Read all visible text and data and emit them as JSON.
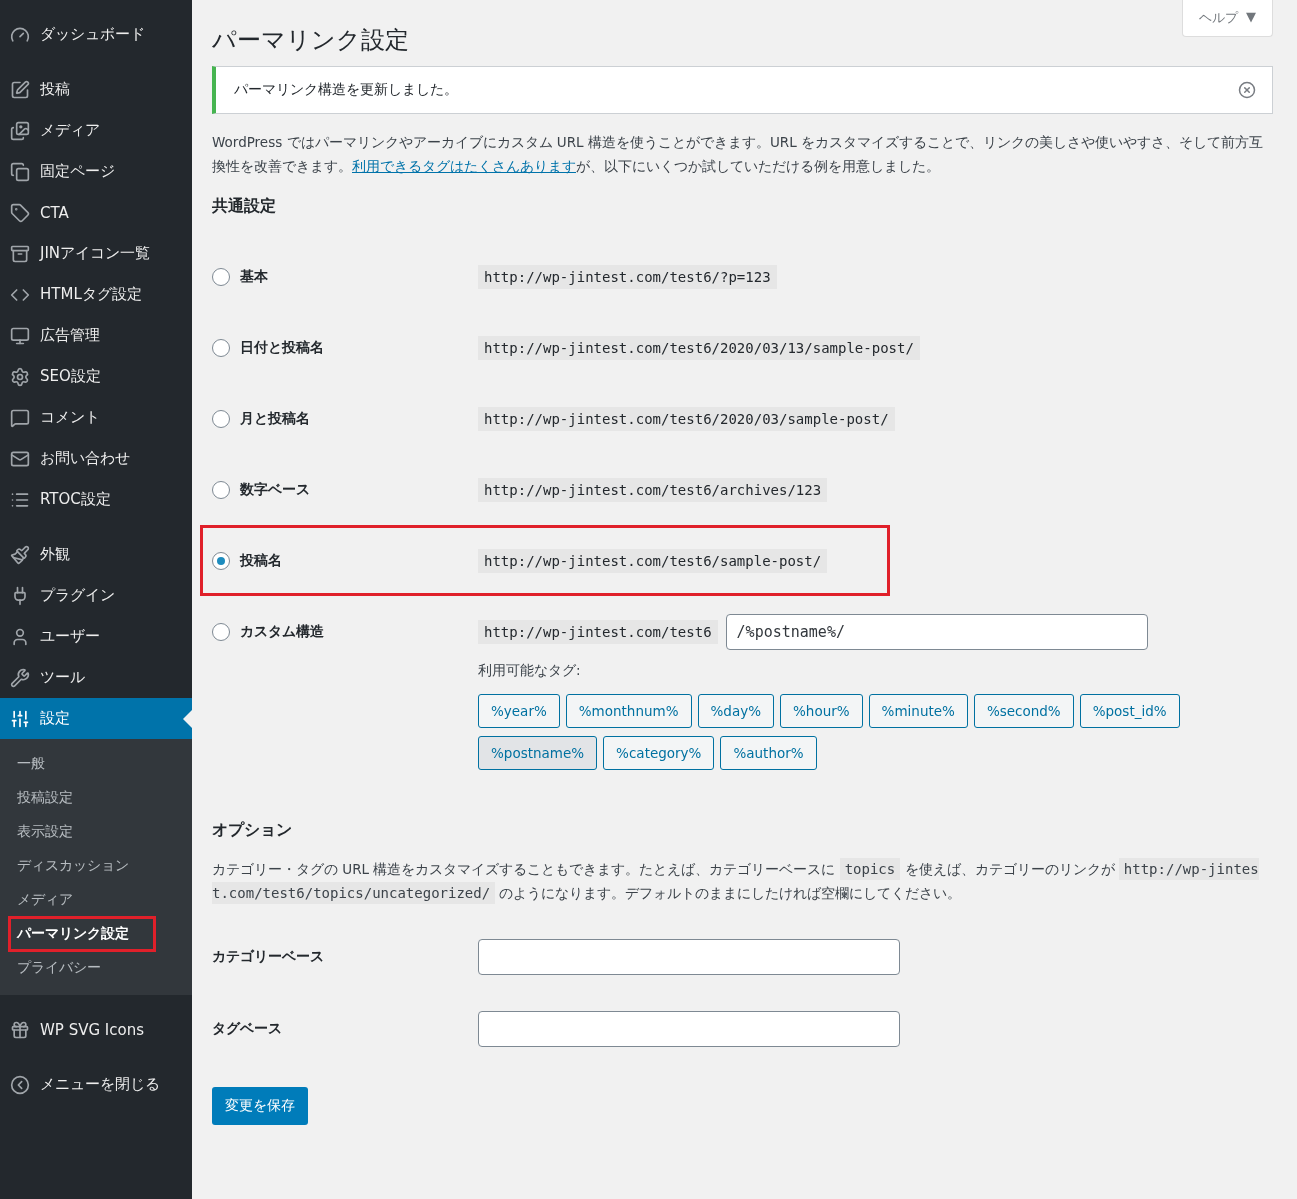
{
  "sidebar": {
    "groups": [
      [
        {
          "label": "ダッシュボード",
          "selected": false
        }
      ],
      [
        {
          "label": "投稿",
          "selected": false
        },
        {
          "label": "メディア",
          "selected": false
        },
        {
          "label": "固定ページ",
          "selected": false
        },
        {
          "label": "CTA",
          "selected": false
        },
        {
          "label": "JINアイコン一覧",
          "selected": false
        },
        {
          "label": "HTMLタグ設定",
          "selected": false
        },
        {
          "label": "広告管理",
          "selected": false
        },
        {
          "label": "SEO設定",
          "selected": false
        },
        {
          "label": "コメント",
          "selected": false
        },
        {
          "label": "お問い合わせ",
          "selected": false
        },
        {
          "label": "RTOC設定",
          "selected": false
        }
      ],
      [
        {
          "label": "外観",
          "selected": false
        },
        {
          "label": "プラグイン",
          "selected": false
        },
        {
          "label": "ユーザー",
          "selected": false
        },
        {
          "label": "ツール",
          "selected": false
        },
        {
          "label": "設定",
          "selected": true,
          "children": [
            {
              "label": "一般",
              "selected": false,
              "highlighted": false
            },
            {
              "label": "投稿設定",
              "selected": false,
              "highlighted": false
            },
            {
              "label": "表示設定",
              "selected": false,
              "highlighted": false
            },
            {
              "label": "ディスカッション",
              "selected": false,
              "highlighted": false
            },
            {
              "label": "メディア",
              "selected": false,
              "highlighted": false
            },
            {
              "label": "パーマリンク設定",
              "selected": true,
              "highlighted": true
            },
            {
              "label": "プライバシー",
              "selected": false,
              "highlighted": false
            }
          ]
        }
      ],
      [
        {
          "label": "WP SVG Icons",
          "selected": false
        }
      ]
    ],
    "collapse": "メニューを閉じる"
  },
  "help_tab": {
    "label": "ヘルプ",
    "caret": "▼"
  },
  "page_title": "パーマリンク設定",
  "notice": {
    "text": "パーマリンク構造を更新しました。"
  },
  "intro": {
    "before": "WordPress ではパーマリンクやアーカイブにカスタム URL 構造を使うことができます。URL をカスタマイズすることで、リンクの美しさや使いやすさ、そして前方互換性を改善できます。",
    "link": "利用できるタグはたくさんあります",
    "after": "が、以下にいくつか試していただける例を用意しました。"
  },
  "common_heading": "共通設定",
  "permalink_options": [
    {
      "label": "基本",
      "example": "http://wp-jintest.com/test6/?p=123",
      "selected": false,
      "highlighted": false
    },
    {
      "label": "日付と投稿名",
      "example": "http://wp-jintest.com/test6/2020/03/13/sample-post/",
      "selected": false,
      "highlighted": false
    },
    {
      "label": "月と投稿名",
      "example": "http://wp-jintest.com/test6/2020/03/sample-post/",
      "selected": false,
      "highlighted": false
    },
    {
      "label": "数字ベース",
      "example": "http://wp-jintest.com/test6/archives/123",
      "selected": false,
      "highlighted": false
    },
    {
      "label": "投稿名",
      "example": "http://wp-jintest.com/test6/sample-post/",
      "selected": true,
      "highlighted": true
    }
  ],
  "custom": {
    "label": "カスタム構造",
    "selected": false,
    "prefix": "http://wp-jintest.com/test6",
    "value": "/%postname%/",
    "tags_label": "利用可能なタグ:",
    "tags": [
      {
        "label": "%year%",
        "selected": false
      },
      {
        "label": "%monthnum%",
        "selected": false
      },
      {
        "label": "%day%",
        "selected": false
      },
      {
        "label": "%hour%",
        "selected": false
      },
      {
        "label": "%minute%",
        "selected": false
      },
      {
        "label": "%second%",
        "selected": false
      },
      {
        "label": "%post_id%",
        "selected": false
      },
      {
        "label": "%postname%",
        "selected": true
      },
      {
        "label": "%category%",
        "selected": false
      },
      {
        "label": "%author%",
        "selected": false
      }
    ]
  },
  "options_heading": "オプション",
  "options_text": [
    {
      "kind": "text",
      "text": "カテゴリー・タグの URL 構造をカスタマイズすることもできます。たとえば、カテゴリーベースに "
    },
    {
      "kind": "code",
      "text": "topics"
    },
    {
      "kind": "text",
      "text": " を使えば、カテゴリーのリンクが "
    },
    {
      "kind": "code",
      "text": "http://wp-jintest.com/test6/topics/uncategorized/"
    },
    {
      "kind": "text",
      "text": " のようになります。デフォルトのままにしたければ空欄にしてください。"
    }
  ],
  "fields": [
    {
      "label": "カテゴリーベース"
    },
    {
      "label": "タグベース"
    }
  ],
  "save_button": "変更を保存"
}
